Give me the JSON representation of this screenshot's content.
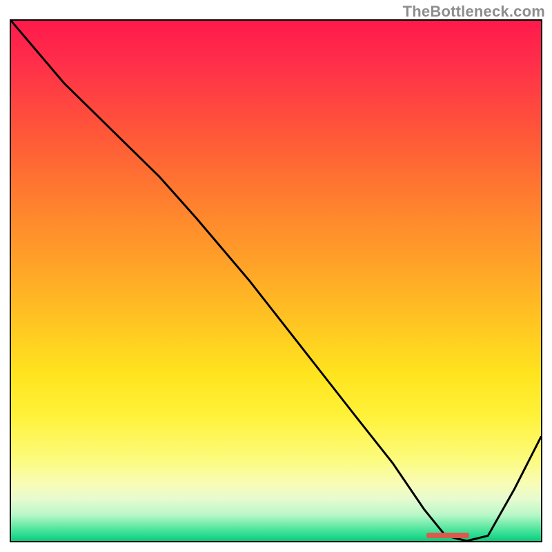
{
  "watermark": "TheBottleneck.com",
  "colors": {
    "gradient_top": "#ff1a4b",
    "gradient_mid": "#ffe41e",
    "gradient_bottom": "#14c57a",
    "curve": "#000000",
    "marker": "#d95a4e",
    "border": "#000000"
  },
  "chart_data": {
    "type": "line",
    "title": "",
    "xlabel": "",
    "ylabel": "",
    "xlim": [
      0,
      100
    ],
    "ylim": [
      0,
      100
    ],
    "x": [
      0,
      5,
      10,
      15,
      20,
      25,
      28,
      35,
      45,
      55,
      65,
      72,
      78,
      82,
      86,
      90,
      95,
      100
    ],
    "values": [
      100,
      94,
      88,
      83,
      78,
      73,
      70,
      62,
      50,
      37,
      24,
      15,
      6,
      1,
      0,
      1,
      10,
      20
    ],
    "marker_range_x": [
      78,
      86
    ],
    "note": "Values are read off the plot as percentages of each axis; y=100 at top, y=0 at bottom. The curve starts at top-left, descends roughly linearly with a slight knee near x≈28, bottoms out near x≈82–86 at the green band, then rises toward the right edge."
  }
}
